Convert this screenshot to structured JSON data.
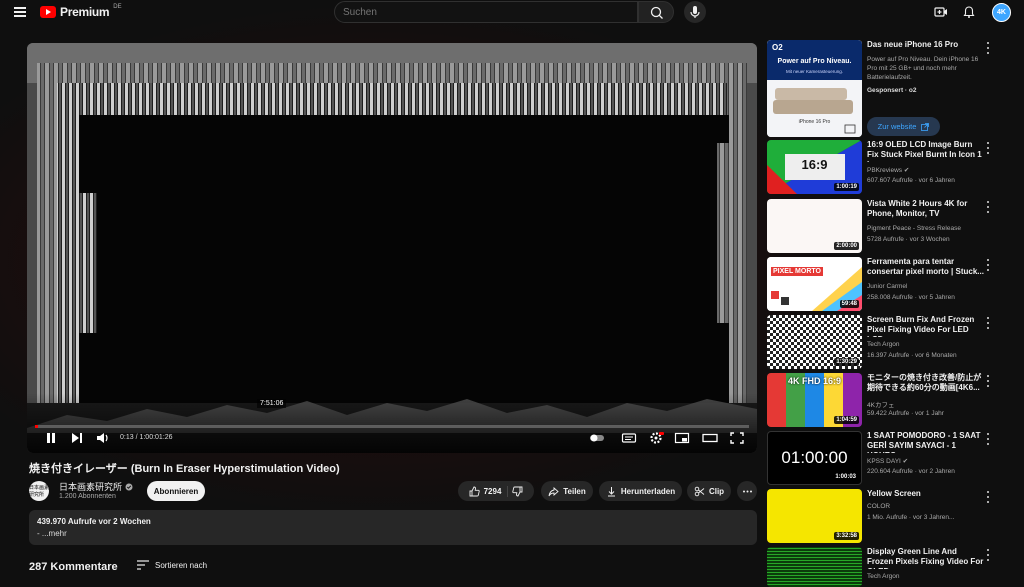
{
  "header": {
    "logo_text": "Premium",
    "logo_region": "DE",
    "search_placeholder": "Suchen",
    "avatar_text": "4K"
  },
  "player": {
    "hover_time": "7:51:06",
    "time_display": "0:13 / 1:00:01:26",
    "progress_fraction": 0.0036
  },
  "video": {
    "title": "焼き付きイレーザー (Burn In Eraser Hyperstimulation Video)",
    "channel_name": "日本画素研究所",
    "channel_avatar_text": "日本画素研究所",
    "subscribers": "1.200 Abonnenten",
    "subscribe_label": "Abonnieren",
    "likes": "7294",
    "share_label": "Teilen",
    "download_label": "Herunterladen",
    "clip_label": "Clip"
  },
  "description": {
    "stats": "439.970 Aufrufe  vor 2 Wochen",
    "more": "- ...mehr"
  },
  "comments": {
    "count_label": "287 Kommentare",
    "sort_label": "Sortieren nach"
  },
  "sidebar": {
    "ad": {
      "title": "Das neue iPhone 16 Pro",
      "body": "Power auf Pro Niveau. Dein iPhone 16 Pro mit 25 GB+ und noch mehr Batterielaufzeit.",
      "sponsor": "Gesponsert · o2",
      "thumb_brand": "O2",
      "thumb_headline": "Power auf Pro Niveau.",
      "thumb_sub": "Mit neuer Kamerasteuerung.",
      "thumb_caption": "iPhone 16 Pro",
      "cta": "Zur website"
    },
    "items": [
      {
        "title": "16:9 OLED LCD Image Burn Fix Stuck Pixel Burnt In Icon 1 hou...",
        "channel": "PBKreviews",
        "meta": "607.607 Aufrufe · vor 6 Jahren",
        "duration": "1:00:19",
        "thumb_text": "16:9",
        "verified": true
      },
      {
        "title": "Vista White 2 Hours 4K for Phone, Monitor, TV",
        "channel": "Pigment Peace - Stress Release",
        "meta": "5728 Aufrufe · vor 3 Wochen",
        "duration": "2:00:00",
        "thumb_text": "",
        "verified": false
      },
      {
        "title": "Ferramenta para tentar consertar pixel morto | Stuck...",
        "channel": "Junior Carmel",
        "meta": "258.008 Aufrufe · vor 5 Jahren",
        "duration": "59:48",
        "thumb_text": "PIXEL MORTO",
        "verified": false
      },
      {
        "title": "Screen Burn Fix And Frozen Pixel Fixing Video For LED LCD...",
        "channel": "Tech Argon",
        "meta": "16.397 Aufrufe · vor 6 Monaten",
        "duration": "1:30:29",
        "thumb_text": "",
        "verified": false
      },
      {
        "title": "モニターの焼き付き改善/防止が期待できる約60分の動画[4K6...",
        "channel": "4Kカフェ",
        "meta": "59.422 Aufrufe · vor 1 Jahr",
        "duration": "1:04:59",
        "thumb_text": "4K FHD 16:9",
        "verified": false
      },
      {
        "title": "1 SAAT POMODORO - 1 SAAT GERİ SAYIM SAYACI - 1 HOURS",
        "channel": "KPSS DAYI",
        "meta": "220.604 Aufrufe · vor 2 Jahren",
        "duration": "1:00:03",
        "thumb_text": "01:00:00",
        "verified": true
      },
      {
        "title": "Yellow Screen",
        "channel": "COLOR",
        "meta": "1 Mio. Aufrufe · vor 3 Jahren...",
        "duration": "3:32:58",
        "thumb_text": "",
        "verified": false
      },
      {
        "title": "Display Green Line And Frozen Pixels Fixing Video For OLED...",
        "channel": "Tech Argon",
        "meta": "",
        "duration": "",
        "thumb_text": "",
        "verified": false
      }
    ]
  }
}
